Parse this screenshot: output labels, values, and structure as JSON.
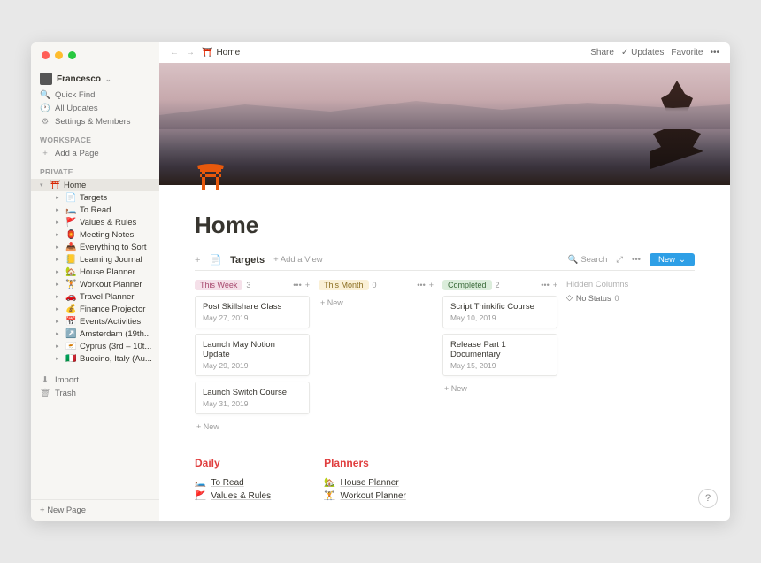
{
  "user": {
    "name": "Francesco"
  },
  "sidebar": {
    "quickfind": "Quick Find",
    "allupdates": "All Updates",
    "settings": "Settings & Members",
    "workspace_label": "WORKSPACE",
    "addpage": "Add a Page",
    "private_label": "PRIVATE",
    "home": "Home",
    "items": [
      {
        "emoji": "📄",
        "label": "Targets"
      },
      {
        "emoji": "🛏️",
        "label": "To Read"
      },
      {
        "emoji": "🚩",
        "label": "Values & Rules"
      },
      {
        "emoji": "🏮",
        "label": "Meeting Notes"
      },
      {
        "emoji": "📥",
        "label": "Everything to Sort"
      },
      {
        "emoji": "📒",
        "label": "Learning Journal"
      },
      {
        "emoji": "🏡",
        "label": "House Planner"
      },
      {
        "emoji": "🏋️",
        "label": "Workout Planner"
      },
      {
        "emoji": "🚗",
        "label": "Travel Planner"
      },
      {
        "emoji": "💰",
        "label": "Finance Projector"
      },
      {
        "emoji": "📅",
        "label": "Events/Activities"
      },
      {
        "emoji": "↗️",
        "label": "Amsterdam (19th..."
      },
      {
        "emoji": "🇨🇾",
        "label": "Cyprus (3rd – 10t..."
      },
      {
        "emoji": "🇮🇹",
        "label": "Buccino, Italy (Au..."
      }
    ],
    "import": "Import",
    "trash": "Trash",
    "newpage": "New Page"
  },
  "topbar": {
    "crumb_icon": "⛩️",
    "crumb": "Home",
    "share": "Share",
    "updates": "Updates",
    "favorite": "Favorite"
  },
  "page": {
    "title": "Home"
  },
  "db": {
    "name": "Targets",
    "addview": "Add a View",
    "search": "Search",
    "new": "New",
    "hidden": "Hidden Columns",
    "nostatus": "No Status",
    "nostatus_count": "0",
    "addnew": "+ New",
    "columns": [
      {
        "tag": "This Week",
        "tagclass": "tag-pink",
        "count": "3",
        "cards": [
          {
            "title": "Post Skillshare Class",
            "date": "May 27, 2019"
          },
          {
            "title": "Launch May Notion Update",
            "date": "May 29, 2019"
          },
          {
            "title": "Launch Switch Course",
            "date": "May 31, 2019"
          }
        ]
      },
      {
        "tag": "This Month",
        "tagclass": "tag-yellow",
        "count": "0",
        "cards": []
      },
      {
        "tag": "Completed",
        "tagclass": "tag-green",
        "count": "2",
        "cards": [
          {
            "title": "Script Thinkific Course",
            "date": "May 10, 2019"
          },
          {
            "title": "Release Part 1 Documentary",
            "date": "May 15, 2019"
          }
        ]
      }
    ]
  },
  "sections": {
    "daily": {
      "title": "Daily",
      "items": [
        {
          "emoji": "🛏️",
          "label": "To Read"
        },
        {
          "emoji": "🚩",
          "label": "Values & Rules"
        }
      ]
    },
    "planners": {
      "title": "Planners",
      "items": [
        {
          "emoji": "🏡",
          "label": "House Planner"
        },
        {
          "emoji": "🏋️",
          "label": "Workout Planner"
        }
      ]
    }
  },
  "help": "?"
}
